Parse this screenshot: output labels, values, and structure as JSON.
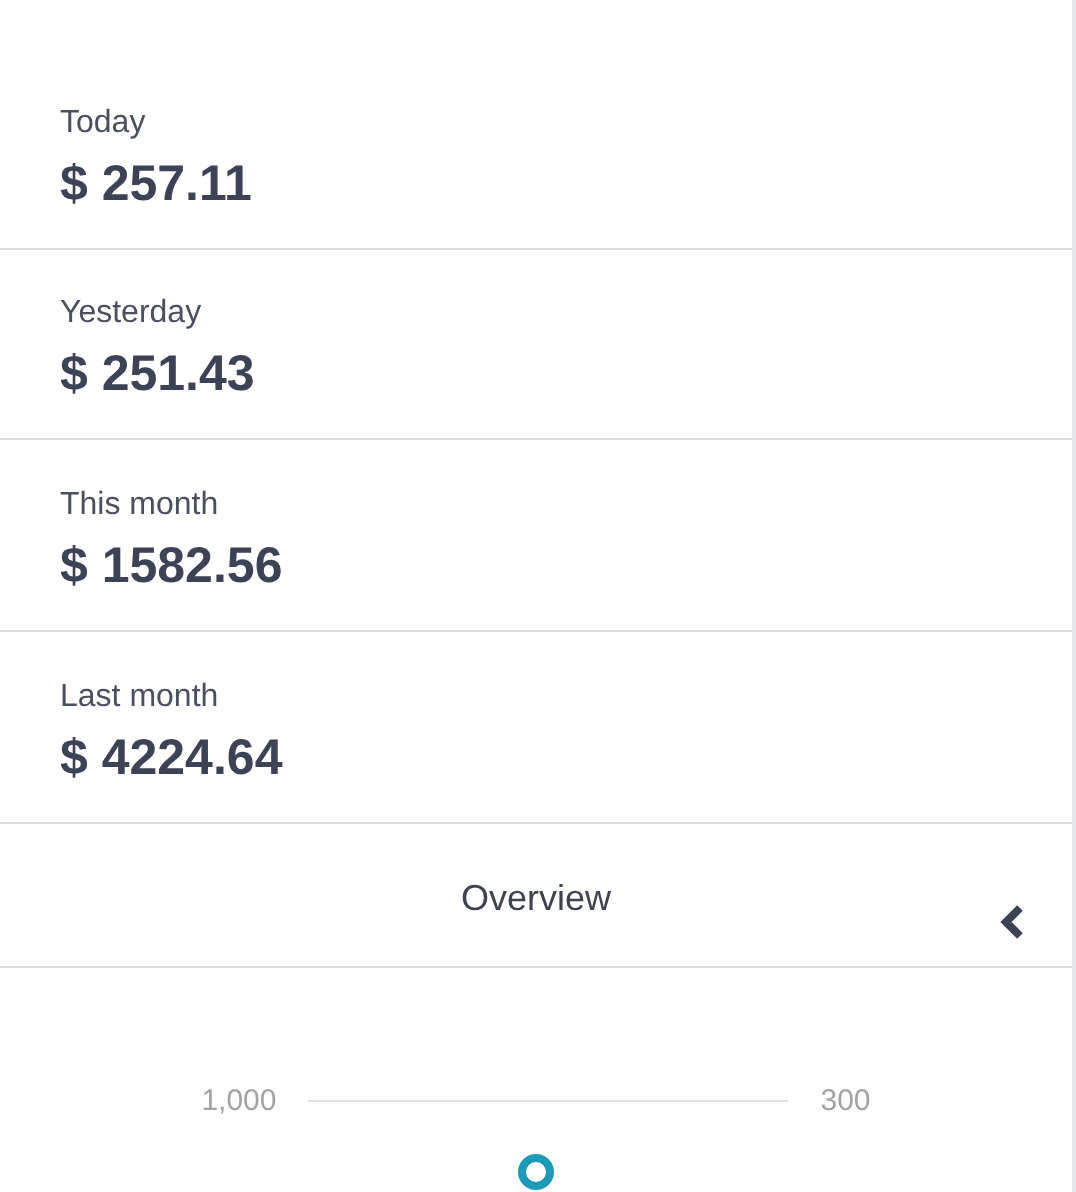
{
  "stats": [
    {
      "label": "Today",
      "value": "$ 257.11"
    },
    {
      "label": "Yesterday",
      "value": "$ 251.43"
    },
    {
      "label": "This month",
      "value": "$ 1582.56"
    },
    {
      "label": "Last month",
      "value": "$ 4224.64"
    }
  ],
  "overview": {
    "title": "Overview"
  },
  "scale": {
    "left_label": "1,000",
    "right_label": "300"
  }
}
